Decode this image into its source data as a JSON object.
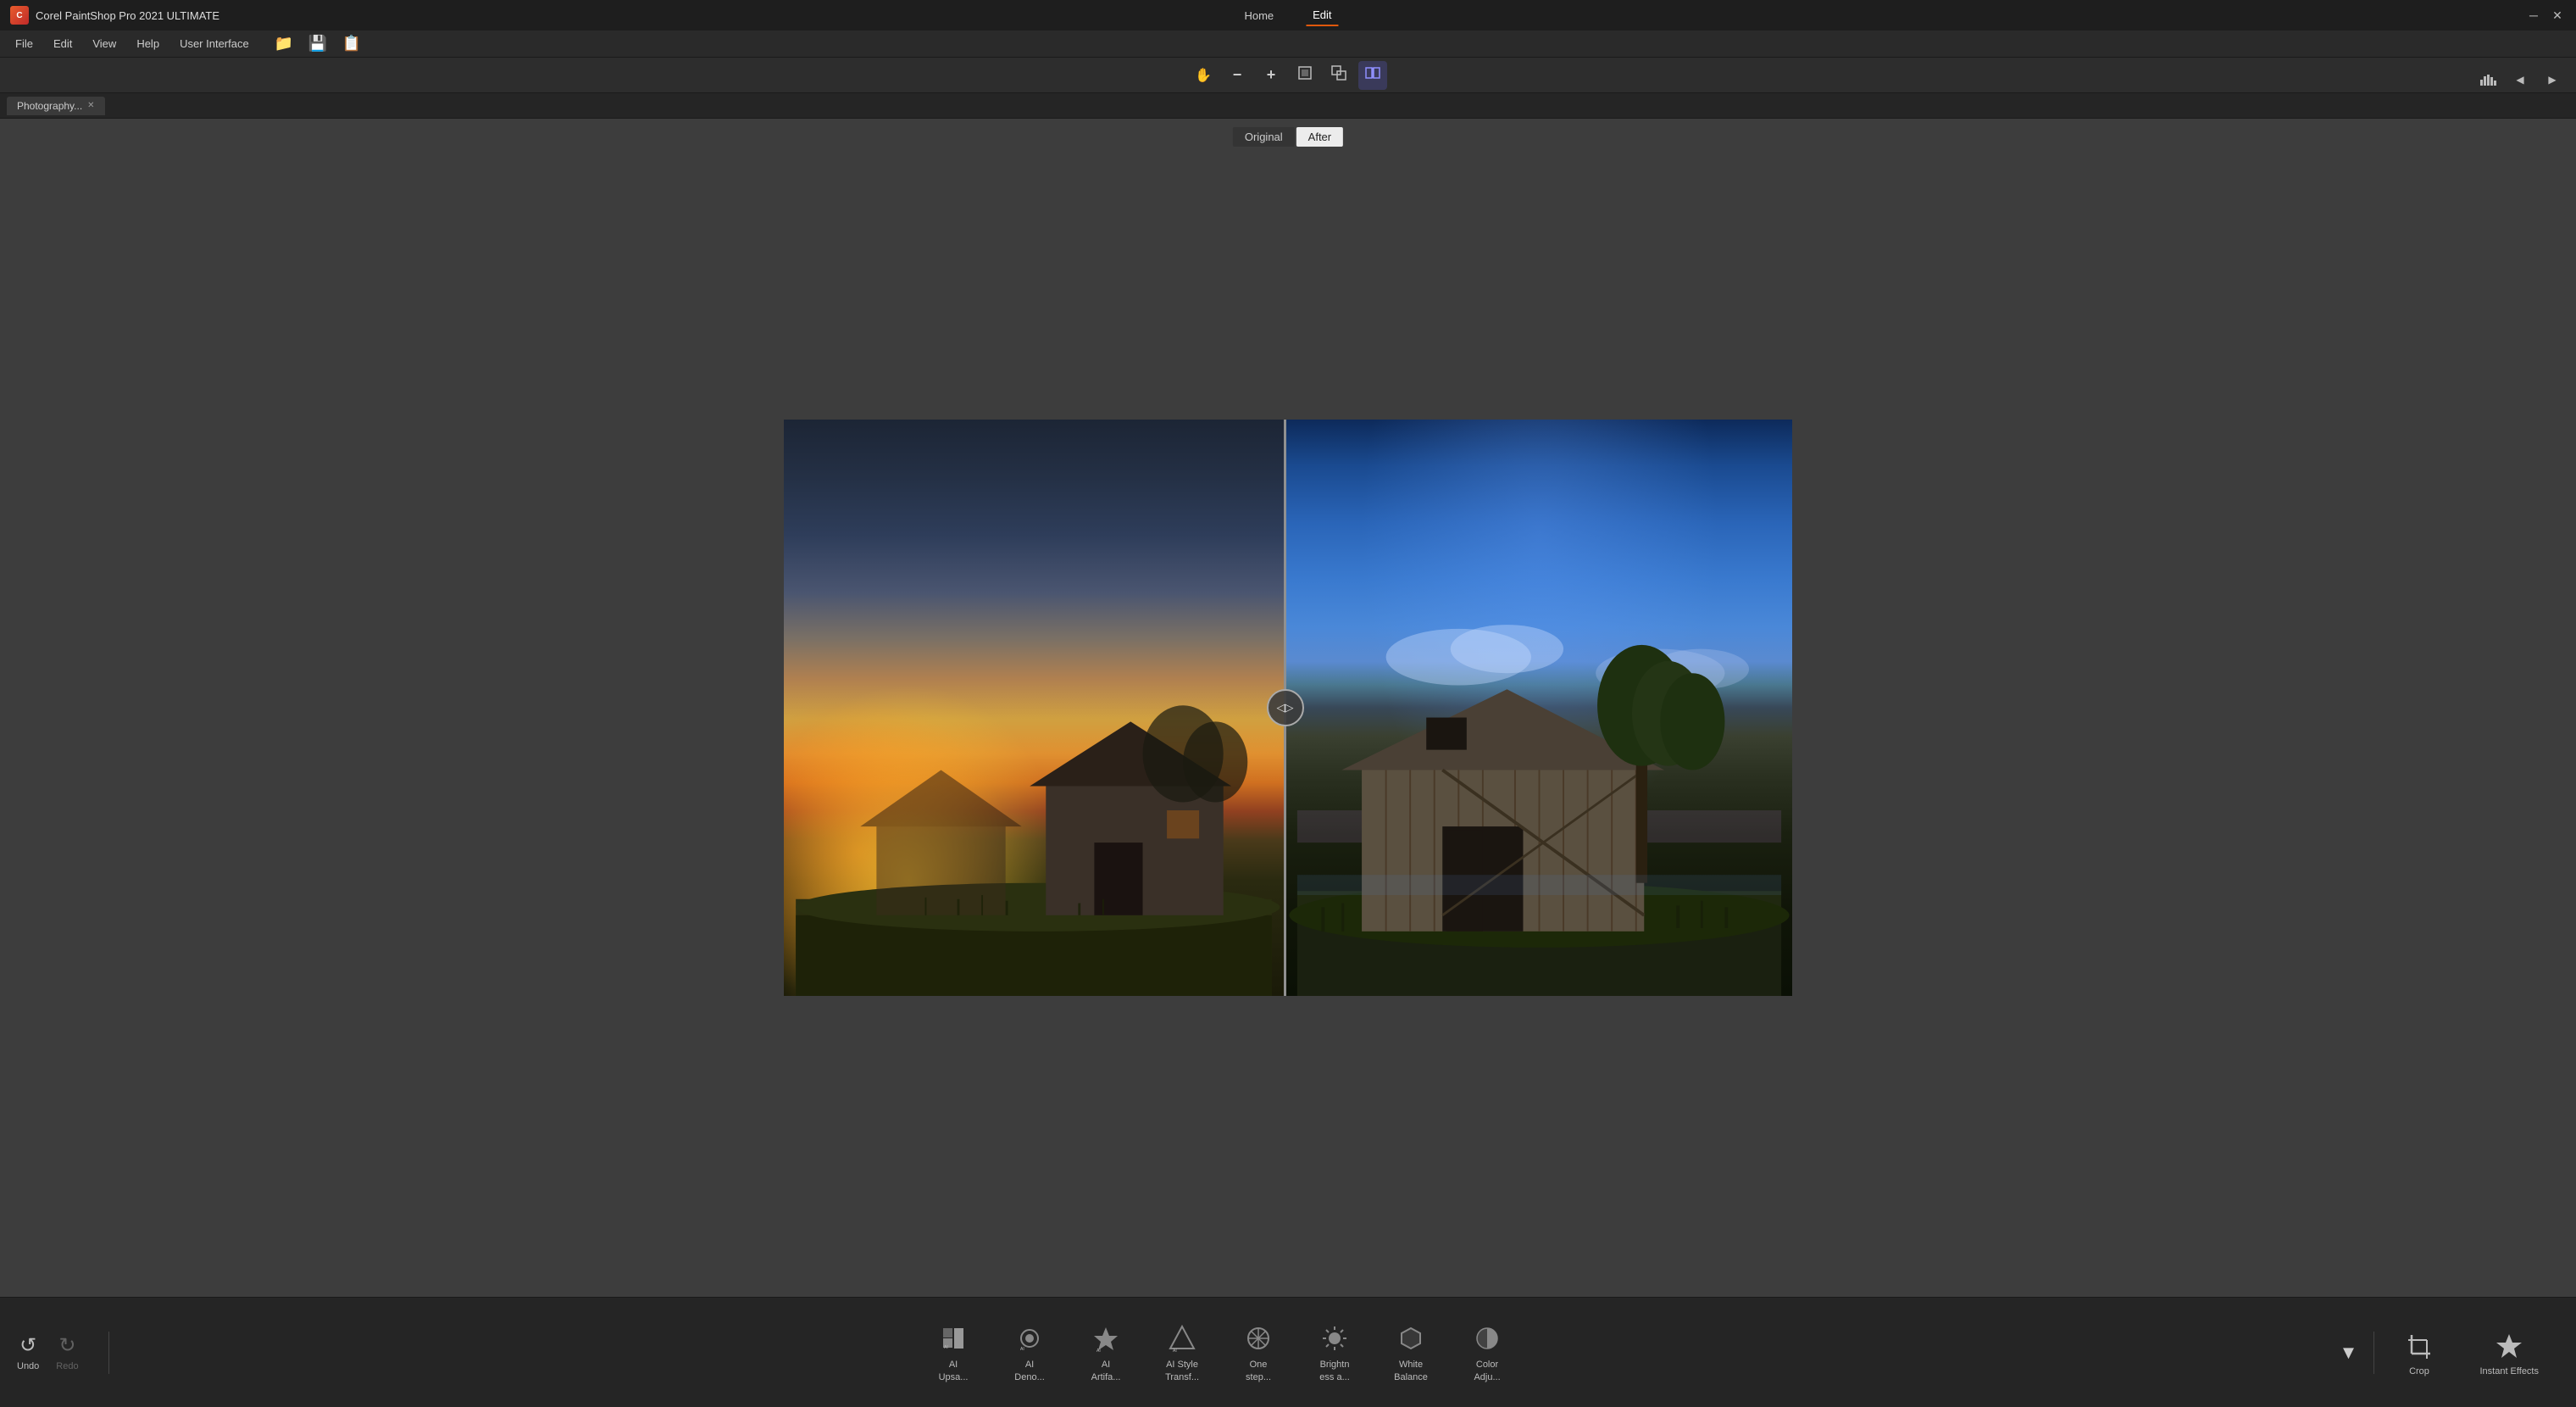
{
  "app": {
    "title": "Corel PaintShop Pro 2021 ULTIMATE",
    "logo_text": "C"
  },
  "titlebar": {
    "title": "Corel PaintShop Pro 2021 ULTIMATE",
    "nav_items": [
      {
        "label": "Home",
        "id": "home",
        "active": false
      },
      {
        "label": "Edit",
        "id": "edit",
        "active": true
      }
    ],
    "min_btn": "─",
    "close_btn": "✕"
  },
  "menubar": {
    "items": [
      {
        "label": "File",
        "id": "file"
      },
      {
        "label": "Edit",
        "id": "edit"
      },
      {
        "label": "View",
        "id": "view"
      },
      {
        "label": "Help",
        "id": "help"
      },
      {
        "label": "User Interface",
        "id": "user-interface"
      }
    ]
  },
  "toolbar": {
    "tools": [
      {
        "id": "hand",
        "icon": "✋",
        "label": "Pan tool"
      },
      {
        "id": "zoom-out",
        "icon": "－",
        "label": "Zoom out"
      },
      {
        "id": "zoom-in",
        "icon": "＋",
        "label": "Zoom in"
      },
      {
        "id": "fit-window",
        "icon": "⊡",
        "label": "Fit in window",
        "active": false
      },
      {
        "id": "crop-view",
        "icon": "⧉",
        "label": "Crop view"
      },
      {
        "id": "compare",
        "icon": "◫",
        "label": "Compare",
        "active": true
      }
    ]
  },
  "tabs": [
    {
      "label": "Photography...",
      "id": "photo-tab",
      "active": true
    }
  ],
  "before_after": {
    "original_label": "Original",
    "after_label": "After"
  },
  "split_handle": {
    "icon": "◁▷"
  },
  "bottom_toolbar": {
    "undo_label": "Undo",
    "redo_label": "Redo",
    "more_icon": "▼",
    "tools": [
      {
        "id": "ai-upsampling",
        "icon": "⬆",
        "label": "AI\nUpsa...",
        "line2": "Upsa..."
      },
      {
        "id": "ai-denoise",
        "icon": "◈",
        "label": "AI\nDeno...",
        "line2": "Deno..."
      },
      {
        "id": "ai-artifact",
        "icon": "✦",
        "label": "AI\nArtifa...",
        "line2": "Artifa..."
      },
      {
        "id": "ai-style",
        "icon": "△",
        "label": "AI Style\nTransf...",
        "line2": "Transf..."
      },
      {
        "id": "one-step",
        "icon": "✱",
        "label": "One\nstep...",
        "line2": "step..."
      },
      {
        "id": "brightness",
        "icon": "☀",
        "label": "Brightn\ness a...",
        "line2": "ess a..."
      },
      {
        "id": "white-balance",
        "icon": "⬡",
        "label": "White\nBalance",
        "line2": "Balance"
      },
      {
        "id": "color-adjust",
        "icon": "◐",
        "label": "Color\nAdju...",
        "line2": "Adju..."
      }
    ],
    "crop_label": "Crop",
    "instant_effects_label": "Instant Effects"
  },
  "right_panel": {
    "tools": [
      {
        "id": "histogram",
        "icon": "▐"
      },
      {
        "id": "info",
        "icon": "◁"
      },
      {
        "id": "layers",
        "icon": "⊞"
      }
    ]
  }
}
